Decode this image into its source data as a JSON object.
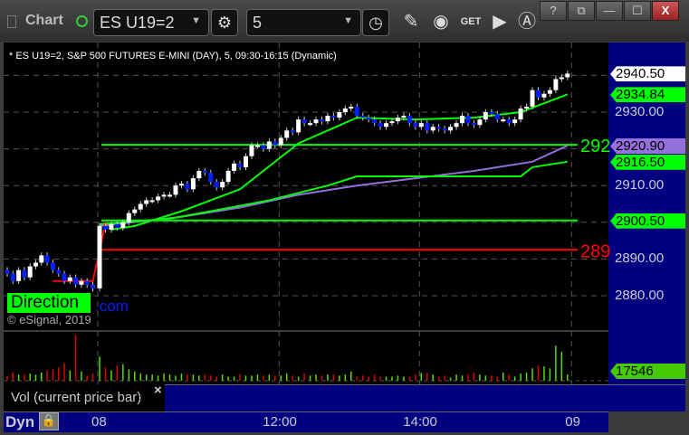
{
  "toolbar": {
    "title": "Chart",
    "symbol": "ES U19=2",
    "interval": "5",
    "window_buttons": [
      "?",
      "⧉",
      "—",
      "☐",
      "X"
    ]
  },
  "subtitle": "* ES U19=2, S&P 500 FUTURES E-MINI (DAY), 5, 09:30-16:15 (Dynamic)",
  "watermark": {
    "text": "Direction",
    "suffix": ".com",
    "copyright": "© eSignal, 2019"
  },
  "legend": {
    "study": "Vol (current price bar)",
    "close": "×"
  },
  "bottom": {
    "dyn": "Dyn"
  },
  "colors": {
    "up": "#ffffff",
    "down": "#0020ff",
    "ma": "#00ff00",
    "vwap": "#9370db",
    "resistance": "#ff0000",
    "axis_bg": "#000080"
  },
  "chart_data": {
    "type": "candlestick",
    "y_ticks": [
      "2930.00",
      "2910.00",
      "2890.00",
      "2880.00"
    ],
    "y_tick_values": [
      2930,
      2910,
      2890,
      2880
    ],
    "ylim": [
      2876,
      2944
    ],
    "x_ticks": [
      {
        "label": "08",
        "bar": 16
      },
      {
        "label": "12:00",
        "bar": 47
      },
      {
        "label": "14:00",
        "bar": 71
      },
      {
        "label": "09",
        "bar": 97
      }
    ],
    "closes": [
      2886,
      2884,
      2887,
      2885,
      2888,
      2889,
      2891,
      2889,
      2887,
      2886,
      2884,
      2885,
      2883,
      2884,
      2883,
      2882,
      2899,
      2898,
      2899.5,
      2898.5,
      2900,
      2902.5,
      2903.5,
      2905,
      2906,
      2906,
      2907,
      2907.5,
      2907.5,
      2910,
      2910.5,
      2909,
      2912,
      2914,
      2913.5,
      2911,
      2909.5,
      2911,
      2914,
      2916,
      2915,
      2918,
      2921,
      2921,
      2920,
      2922,
      2921,
      2923,
      2925,
      2924.5,
      2928,
      2927,
      2927,
      2928,
      2927.5,
      2929,
      2928.5,
      2930,
      2931,
      2931.5,
      2929,
      2928.5,
      2928,
      2927,
      2926,
      2927,
      2927.5,
      2928.5,
      2929,
      2927,
      2926,
      2927,
      2925,
      2926,
      2925.5,
      2925,
      2926,
      2927,
      2929,
      2927,
      2926.5,
      2928,
      2930,
      2929.5,
      2928,
      2928,
      2927,
      2928,
      2931,
      2931.5,
      2936,
      2934,
      2935,
      2936,
      2939,
      2939.5,
      2940.5
    ],
    "volume": [
      9000,
      16000,
      12000,
      12000,
      14000,
      12000,
      16000,
      20000,
      22000,
      26000,
      34000,
      20000,
      89000,
      18000,
      10000,
      14000,
      47000,
      26000,
      20000,
      30000,
      32000,
      22000,
      18000,
      14000,
      12000,
      12000,
      10000,
      14000,
      12000,
      10000,
      14000,
      12000,
      12000,
      10000,
      12000,
      10000,
      8000,
      12000,
      8000,
      8000,
      12000,
      10000,
      10000,
      12000,
      10000,
      12000,
      10000,
      10000,
      14000,
      10000,
      8000,
      14000,
      10000,
      12000,
      10000,
      12000,
      12000,
      10000,
      12000,
      18000,
      8000,
      10000,
      8000,
      12000,
      8000,
      8000,
      8000,
      10000,
      8000,
      8000,
      12000,
      15000,
      15000,
      12000,
      8000,
      10000,
      6000,
      12000,
      10000,
      12000,
      16000,
      12000,
      10000,
      10000,
      8000,
      16000,
      12000,
      8000,
      14000,
      16000,
      24000,
      30000,
      28000,
      24000,
      68000,
      56000,
      12000,
      17546
    ],
    "overlays": [
      {
        "kind": "ma",
        "color": "#00ff00",
        "points": [
          [
            18,
            2898
          ],
          [
            22,
            2899
          ],
          [
            30,
            2903
          ],
          [
            40,
            2909
          ],
          [
            50,
            2921.5
          ],
          [
            60,
            2928.5
          ],
          [
            70,
            2928
          ],
          [
            80,
            2928.5
          ],
          [
            88,
            2930
          ],
          [
            96,
            2934.84
          ]
        ]
      },
      {
        "kind": "vwap",
        "color": "#9370db",
        "points": [
          [
            16,
            2899
          ],
          [
            30,
            2901.5
          ],
          [
            40,
            2904
          ],
          [
            50,
            2907.5
          ],
          [
            60,
            2910
          ],
          [
            70,
            2912
          ],
          [
            80,
            2914
          ],
          [
            90,
            2916.5
          ],
          [
            96,
            2920.9
          ]
        ]
      },
      {
        "kind": "step",
        "color": "#00ff00",
        "points": [
          [
            16,
            2899.5
          ],
          [
            28,
            2901
          ],
          [
            35,
            2903
          ],
          [
            45,
            2906
          ],
          [
            55,
            2910
          ],
          [
            60,
            2912.5
          ],
          [
            88,
            2912.5
          ],
          [
            90,
            2915
          ],
          [
            96,
            2916.5
          ]
        ]
      },
      {
        "kind": "prior",
        "color": "#ff0000",
        "points": [
          [
            8,
            2884
          ],
          [
            15,
            2884
          ],
          [
            16,
            2892
          ],
          [
            17,
            2900
          ]
        ]
      }
    ],
    "levels": [
      {
        "value": 2921.1,
        "color": "#00ff00",
        "label": "292"
      },
      {
        "value": 2900.5,
        "color": "#00ff00",
        "label": ""
      },
      {
        "value": 2892.5,
        "color": "#ff0000",
        "label": "289"
      }
    ],
    "price_tags": [
      {
        "text": "2940.50",
        "value": 2940.5,
        "bg": "#ffffff"
      },
      {
        "text": "2934.84",
        "value": 2934.84,
        "bg": "#00ff00"
      },
      {
        "text": "2920.90",
        "value": 2920.9,
        "bg": "#9370db"
      },
      {
        "text": "2916.50",
        "value": 2916.5,
        "bg": "#00ff00"
      },
      {
        "text": "2900.50",
        "value": 2900.5,
        "bg": "#00ff00"
      }
    ],
    "volume_tag": {
      "text": "17546",
      "bg": "#44cc00"
    }
  }
}
